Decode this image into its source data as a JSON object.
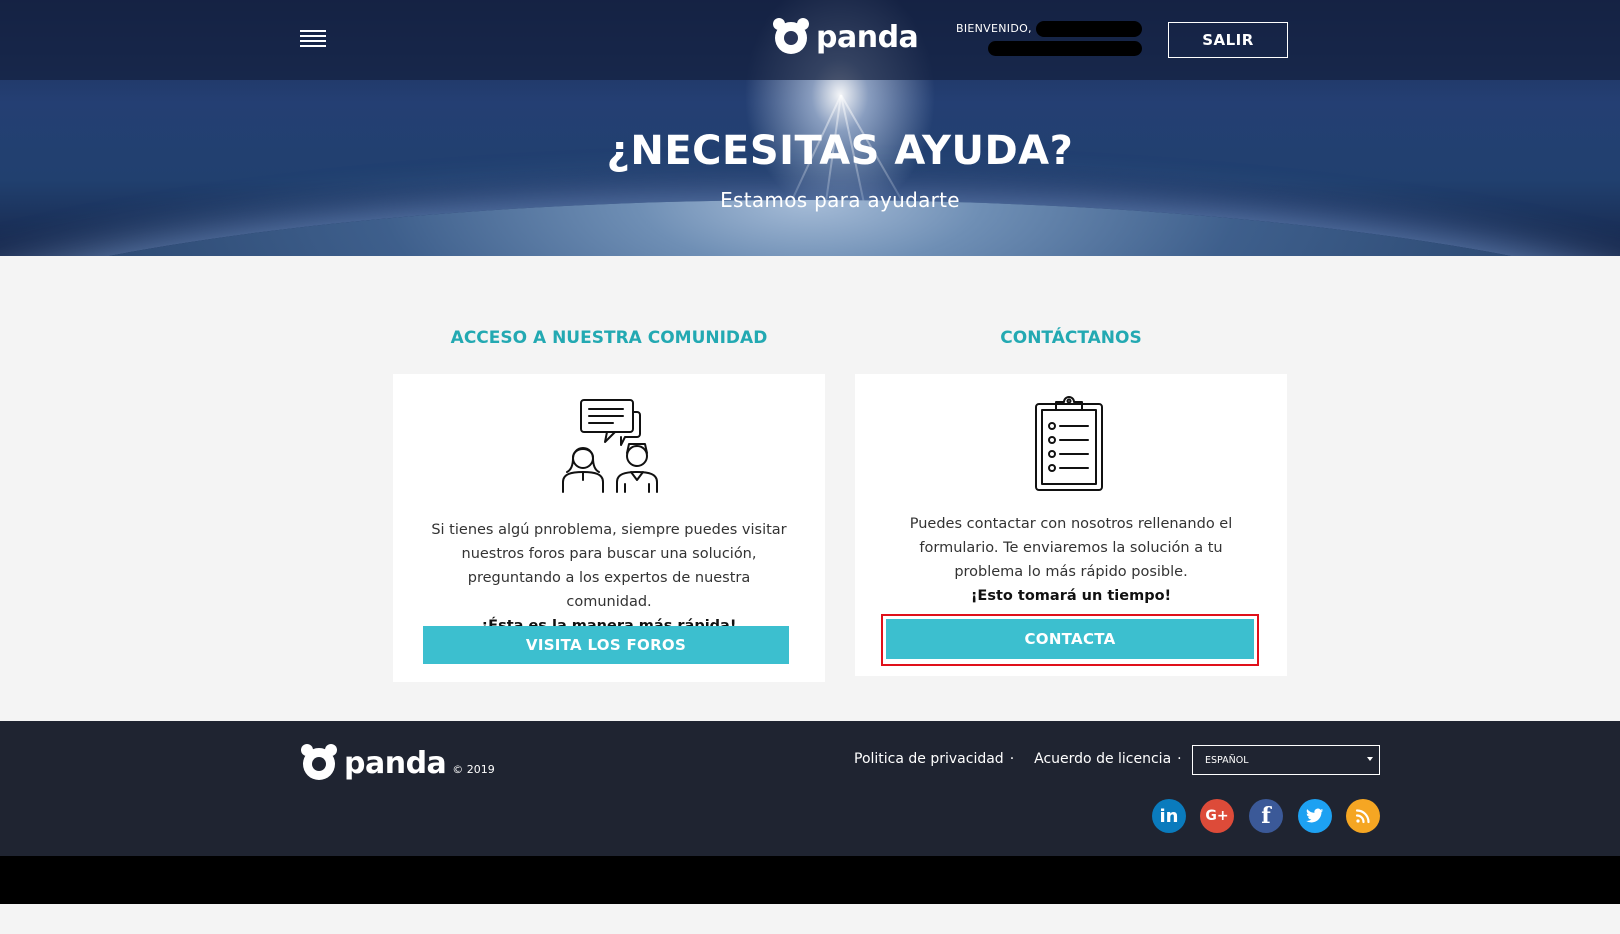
{
  "header": {
    "logo_text": "panda",
    "welcome_label": "BIENVENIDO,",
    "logout_label": "SALIR"
  },
  "hero": {
    "title": "¿NECESITAS AYUDA?",
    "subtitle": "Estamos para ayudarte"
  },
  "community": {
    "title": "ACCESO A NUESTRA COMUNIDAD",
    "text": "Si tienes algú pnroblema, siempre puedes visitar nuestros foros para buscar una solución, preguntando a los expertos de nuestra comunidad.",
    "bold": "¡Ésta es la manera más rápida!",
    "button": "VISITA LOS FOROS"
  },
  "contact": {
    "title": "CONTÁCTANOS",
    "text": "Puedes contactar con nosotros rellenando el formulario. Te enviaremos la solución a tu problema lo más rápido posible.",
    "bold": "¡Esto tomará un tiempo!",
    "button": "CONTACTA"
  },
  "footer": {
    "logo_text": "panda",
    "copyright": "© 2019",
    "links": [
      "Politica de privacidad",
      "Acuerdo de licencia"
    ],
    "link_separator": "·",
    "language": "ESPAÑOL",
    "social": [
      {
        "name": "linkedin",
        "label": "in",
        "color": "#0a7bbd"
      },
      {
        "name": "google-plus",
        "label": "G+",
        "color": "#dd4b39"
      },
      {
        "name": "facebook",
        "label": "f",
        "color": "#3b5998"
      },
      {
        "name": "twitter",
        "label": "🐦",
        "color": "#1da1f2"
      },
      {
        "name": "rss",
        "label": "◉",
        "color": "#f5a623"
      }
    ]
  },
  "colors": {
    "accent": "#3cbfcf",
    "title_teal": "#23a9b2",
    "footer_bg": "#1f2431",
    "highlight": "#e0101a"
  }
}
